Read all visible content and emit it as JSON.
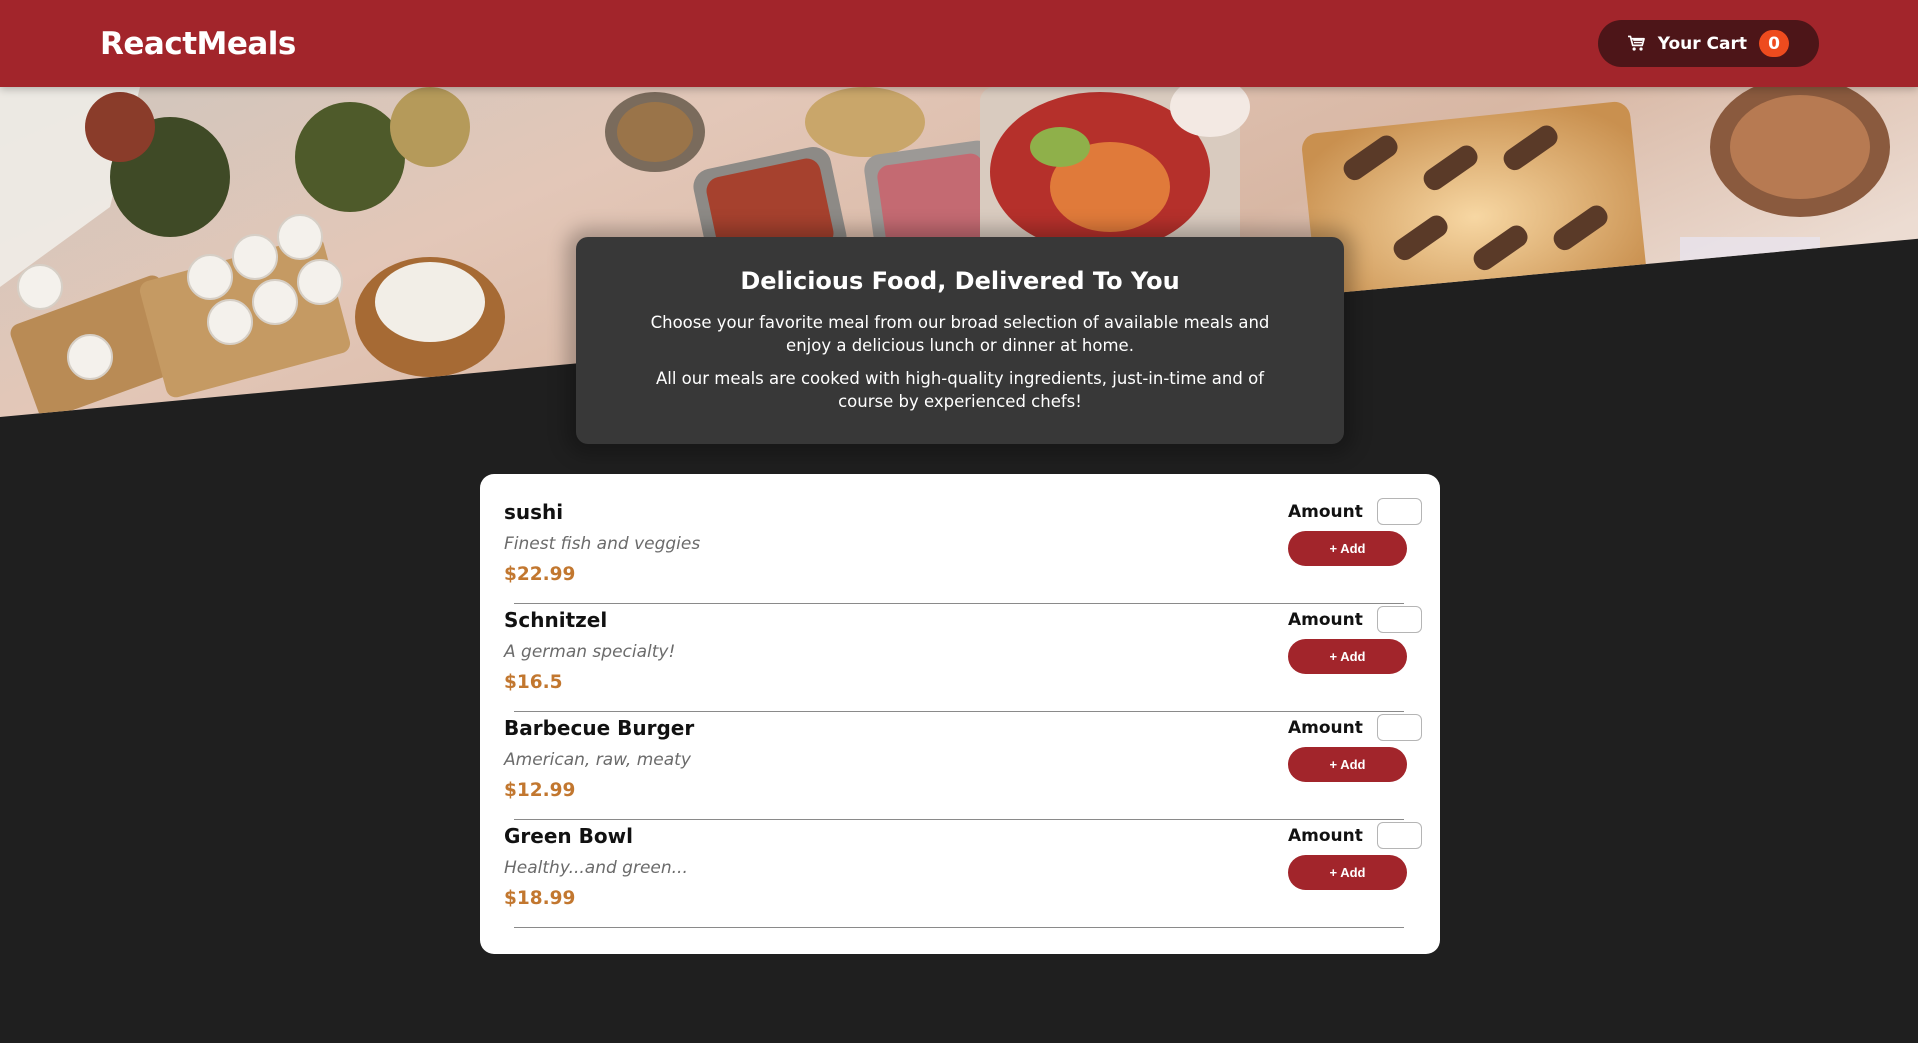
{
  "header": {
    "brand": "ReactMeals",
    "cart_label": "Your Cart",
    "cart_count": "0"
  },
  "summary": {
    "title": "Delicious Food, Delivered To You",
    "paragraph_1": "Choose your favorite meal from our broad selection of available meals and enjoy a delicious lunch or dinner at home.",
    "paragraph_2": "All our meals are cooked with high-quality ingredients, just-in-time and of course by experienced chefs!"
  },
  "meals": [
    {
      "name": "sushi",
      "description": "Finest fish and veggies",
      "price": "$22.99",
      "amount_label": "Amount",
      "add_label": "+ Add"
    },
    {
      "name": "Schnitzel",
      "description": "A german specialty!",
      "price": "$16.5",
      "amount_label": "Amount",
      "add_label": "+ Add"
    },
    {
      "name": "Barbecue Burger",
      "description": "American, raw, meaty",
      "price": "$12.99",
      "amount_label": "Amount",
      "add_label": "+ Add"
    },
    {
      "name": "Green Bowl",
      "description": "Healthy...and green...",
      "price": "$18.99",
      "amount_label": "Amount",
      "add_label": "+ Add"
    }
  ],
  "colors": {
    "header": "#a2252b",
    "cart_button": "#4d1518",
    "badge": "#ee4b1e",
    "page_background": "#1f1f1f",
    "summary_card": "#383838",
    "price": "#c2772f",
    "add_button": "#a2252b"
  },
  "icons": {
    "cart": "shopping-cart-icon"
  }
}
